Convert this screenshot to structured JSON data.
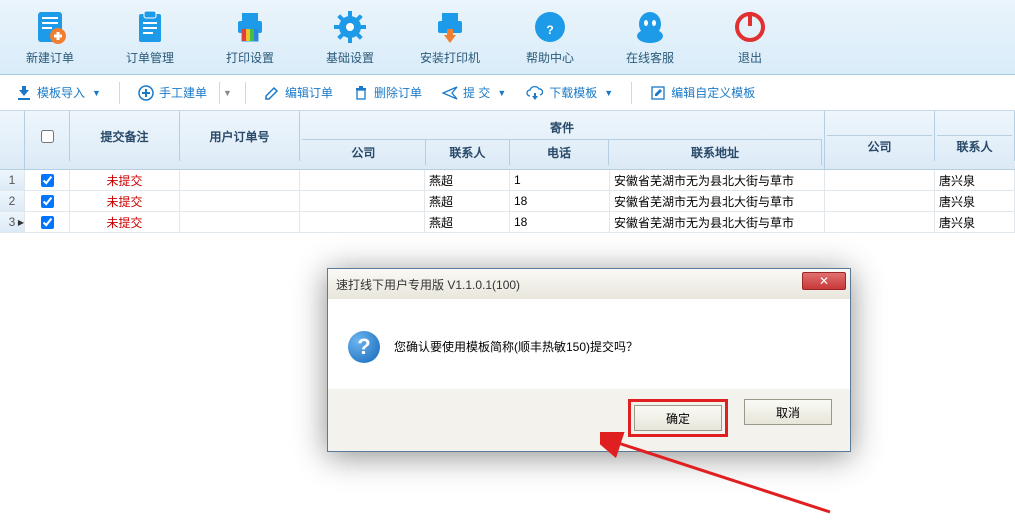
{
  "main_toolbar": {
    "new_order": "新建订单",
    "order_mgmt": "订单管理",
    "print_setting": "打印设置",
    "base_setting": "基础设置",
    "install_printer": "安装打印机",
    "help": "帮助中心",
    "online_service": "在线客服",
    "exit": "退出"
  },
  "sub_toolbar": {
    "import_tpl": "模板导入",
    "manual_create": "手工建单",
    "edit_order": "编辑订单",
    "delete_order": "删除订单",
    "submit": "提 交",
    "download_tpl": "下载模板",
    "edit_custom_tpl": "编辑自定义模板"
  },
  "grid": {
    "head": {
      "remark": "提交备注",
      "user_order_no": "用户订单号",
      "sender": "寄件",
      "company": "公司",
      "contact": "联系人",
      "phone": "电话",
      "addr": "联系地址",
      "company2": "公司",
      "contact2": "联系人"
    },
    "rows": [
      {
        "idx": "1",
        "remark": "未提交",
        "contact": "燕超",
        "phone": "1",
        "addr": "安徽省芜湖市无为县北大街与草市",
        "contact2": "唐兴泉"
      },
      {
        "idx": "2",
        "remark": "未提交",
        "contact": "燕超",
        "phone": "18",
        "addr": "安徽省芜湖市无为县北大街与草市",
        "contact2": "唐兴泉"
      },
      {
        "idx": "3",
        "remark": "未提交",
        "contact": "燕超",
        "phone": "18",
        "addr": "安徽省芜湖市无为县北大街与草市",
        "contact2": "唐兴泉"
      }
    ]
  },
  "dialog": {
    "title": "速打线下用户专用版 V1.1.0.1(100)",
    "message": "您确认要使用模板简称(顺丰热敏150)提交吗？",
    "ok": "确定",
    "cancel": "取消"
  }
}
